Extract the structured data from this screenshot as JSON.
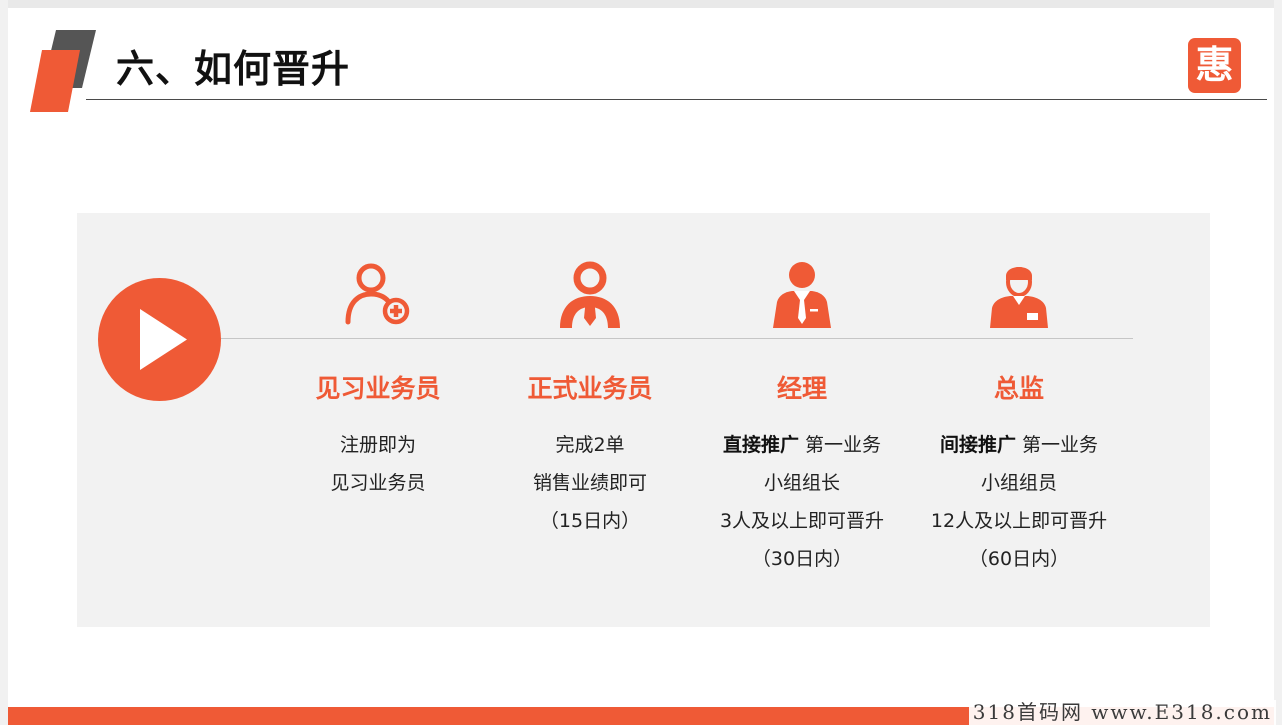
{
  "header": {
    "title": "六、如何晋升",
    "logo_char": "惠"
  },
  "colors": {
    "accent": "#ef5a36",
    "deco_dark": "#555555",
    "panel_bg": "#f2f2f2"
  },
  "stages": [
    {
      "icon": "user-add-icon",
      "title": "见习业务员",
      "lines": [
        "注册即为",
        "见习业务员"
      ]
    },
    {
      "icon": "person-tie-icon",
      "title": "正式业务员",
      "lines": [
        "完成2单",
        "销售业绩即可",
        "（15日内）"
      ]
    },
    {
      "icon": "manager-suit-icon",
      "title": "经理",
      "bold_lead": "直接推广",
      "lead_rest": " 第一业务",
      "lines": [
        "小组组长",
        "3人及以上即可晋升",
        "（30日内）"
      ]
    },
    {
      "icon": "director-icon",
      "title": "总监",
      "bold_lead": "间接推广",
      "lead_rest": " 第一业务",
      "lines": [
        "小组组员",
        "12人及以上即可晋升",
        "（60日内）"
      ]
    }
  ],
  "watermark": "318首码网 www.E318.com"
}
